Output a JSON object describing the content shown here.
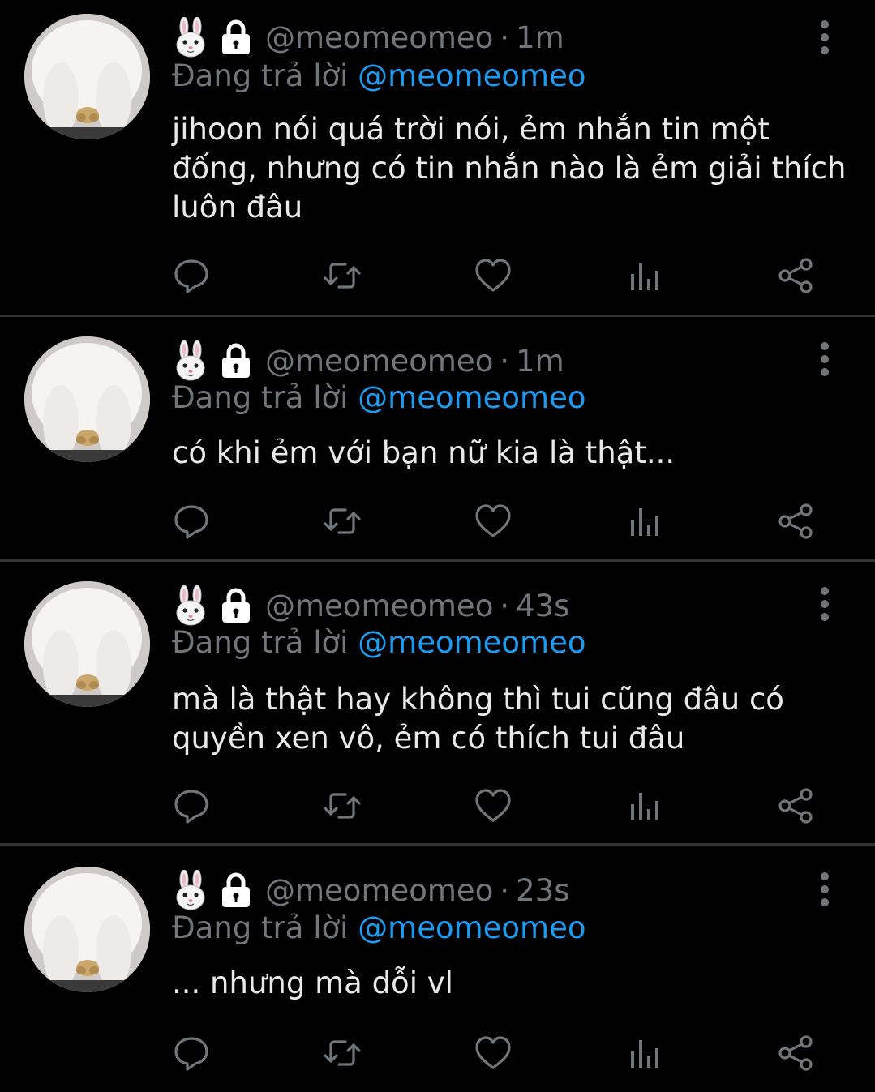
{
  "colors": {
    "background": "#000000",
    "text": "#e7e9ea",
    "muted": "#71767b",
    "mention": "#1d9bf0",
    "divider": "#2f3336"
  },
  "tweets": [
    {
      "handle": "@meomeomeo",
      "separator": "·",
      "time": "1m",
      "replying_label": "Đang trả lời",
      "replying_to": "@meomeomeo",
      "text": "jihoon nói quá trời nói, ẻm nhắn tin một đống, nhưng có tin nhắn nào là ẻm giải thích luôn đâu",
      "icons": [
        "rabbit-emoji",
        "lock-icon",
        "more-icon",
        "reply-icon",
        "retweet-icon",
        "like-icon",
        "views-icon",
        "share-icon"
      ]
    },
    {
      "handle": "@meomeomeo",
      "separator": "·",
      "time": "1m",
      "replying_label": "Đang trả lời",
      "replying_to": "@meomeomeo",
      "text": "có khi ẻm với bạn nữ kia là thật...",
      "icons": [
        "rabbit-emoji",
        "lock-icon",
        "more-icon",
        "reply-icon",
        "retweet-icon",
        "like-icon",
        "views-icon",
        "share-icon"
      ]
    },
    {
      "handle": "@meomeomeo",
      "separator": "·",
      "time": "43s",
      "replying_label": "Đang trả lời",
      "replying_to": "@meomeomeo",
      "text": "mà là thật hay không thì tui cũng đâu có quyền xen vô, ẻm có thích tui đâu",
      "icons": [
        "rabbit-emoji",
        "lock-icon",
        "more-icon",
        "reply-icon",
        "retweet-icon",
        "like-icon",
        "views-icon",
        "share-icon"
      ]
    },
    {
      "handle": "@meomeomeo",
      "separator": "·",
      "time": "23s",
      "replying_label": "Đang trả lời",
      "replying_to": "@meomeomeo",
      "text": "... nhưng mà dỗi vl",
      "icons": [
        "rabbit-emoji",
        "lock-icon",
        "more-icon",
        "reply-icon",
        "retweet-icon",
        "like-icon",
        "views-icon",
        "share-icon"
      ]
    }
  ]
}
